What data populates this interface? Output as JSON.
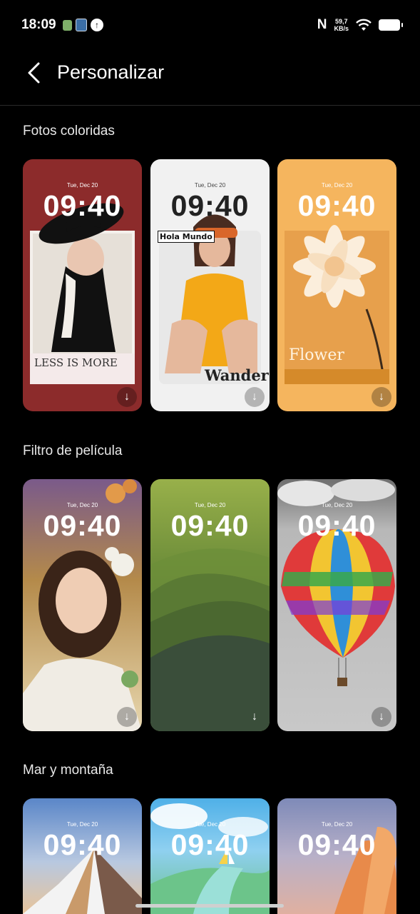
{
  "status": {
    "time": "18:09",
    "speed_value": "59,7",
    "speed_unit": "KB/s"
  },
  "header": {
    "title": "Personalizar"
  },
  "sections": [
    {
      "title": "Fotos coloridas",
      "cards": [
        {
          "date": "Tue, Dec 20",
          "time": "09:40",
          "caption": "LESS IS MORE"
        },
        {
          "date": "Tue, Dec 20",
          "time": "09:40",
          "caption": "Wander",
          "badge": "Hola Mundo"
        },
        {
          "date": "Tue, Dec 20",
          "time": "09:40",
          "caption": "Flower"
        }
      ]
    },
    {
      "title": "Filtro de película",
      "cards": [
        {
          "date": "Tue, Dec 20",
          "time": "09:40"
        },
        {
          "date": "Tue, Dec 20",
          "time": "09:40"
        },
        {
          "date": "Tue, Dec 20",
          "time": "09:40"
        }
      ]
    },
    {
      "title": "Mar y montaña",
      "cards": [
        {
          "date": "Tue, Dec 20",
          "time": "09:40"
        },
        {
          "date": "Tue, Dec 20",
          "time": "09:40"
        },
        {
          "date": "Tue, Dec 20",
          "time": "09:40"
        }
      ]
    }
  ],
  "icons": {
    "back": "back-arrow-icon",
    "download": "download-icon",
    "wifi": "wifi-icon",
    "battery": "battery-icon",
    "nfc": "nfc-icon"
  }
}
